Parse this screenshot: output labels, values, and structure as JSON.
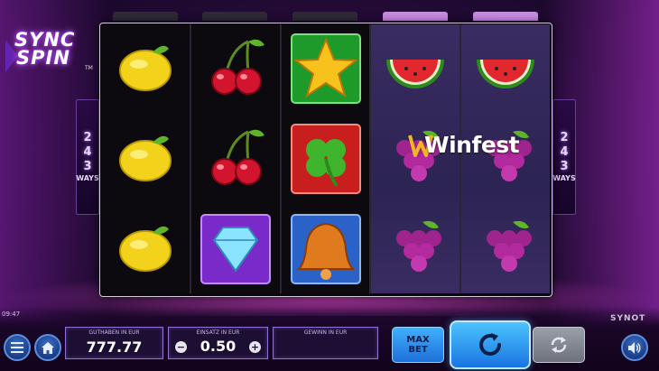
{
  "game": {
    "logo_line1": "SYNC",
    "logo_line2": "SPIN",
    "logo_tm": "TM",
    "ways_number_digits": [
      "2",
      "4",
      "3"
    ],
    "ways_word": "WAYS",
    "brand": "SYNOT",
    "clock": "09:47"
  },
  "reels": [
    [
      "lemon",
      "lemon",
      "lemon"
    ],
    [
      "cherries",
      "cherries",
      "diamond"
    ],
    [
      "star",
      "clover",
      "bell"
    ],
    [
      "watermelon",
      "grapes",
      "grapes"
    ],
    [
      "watermelon",
      "grapes",
      "grapes"
    ]
  ],
  "watermark": "Winfest",
  "panel": {
    "balance_label": "GUTHABEN IN EUR",
    "balance_value": "777.77",
    "bet_label": "EINSATZ IN EUR",
    "bet_value": "0.50",
    "win_label": "GEWINN IN EUR",
    "win_value": ""
  },
  "buttons": {
    "maxbet_line1": "MAX",
    "maxbet_line2": "BET",
    "icons": {
      "menu": "menu-icon",
      "home": "home-icon",
      "spin": "spin-icon",
      "autoplay": "autoplay-icon",
      "sound": "sound-icon"
    }
  }
}
